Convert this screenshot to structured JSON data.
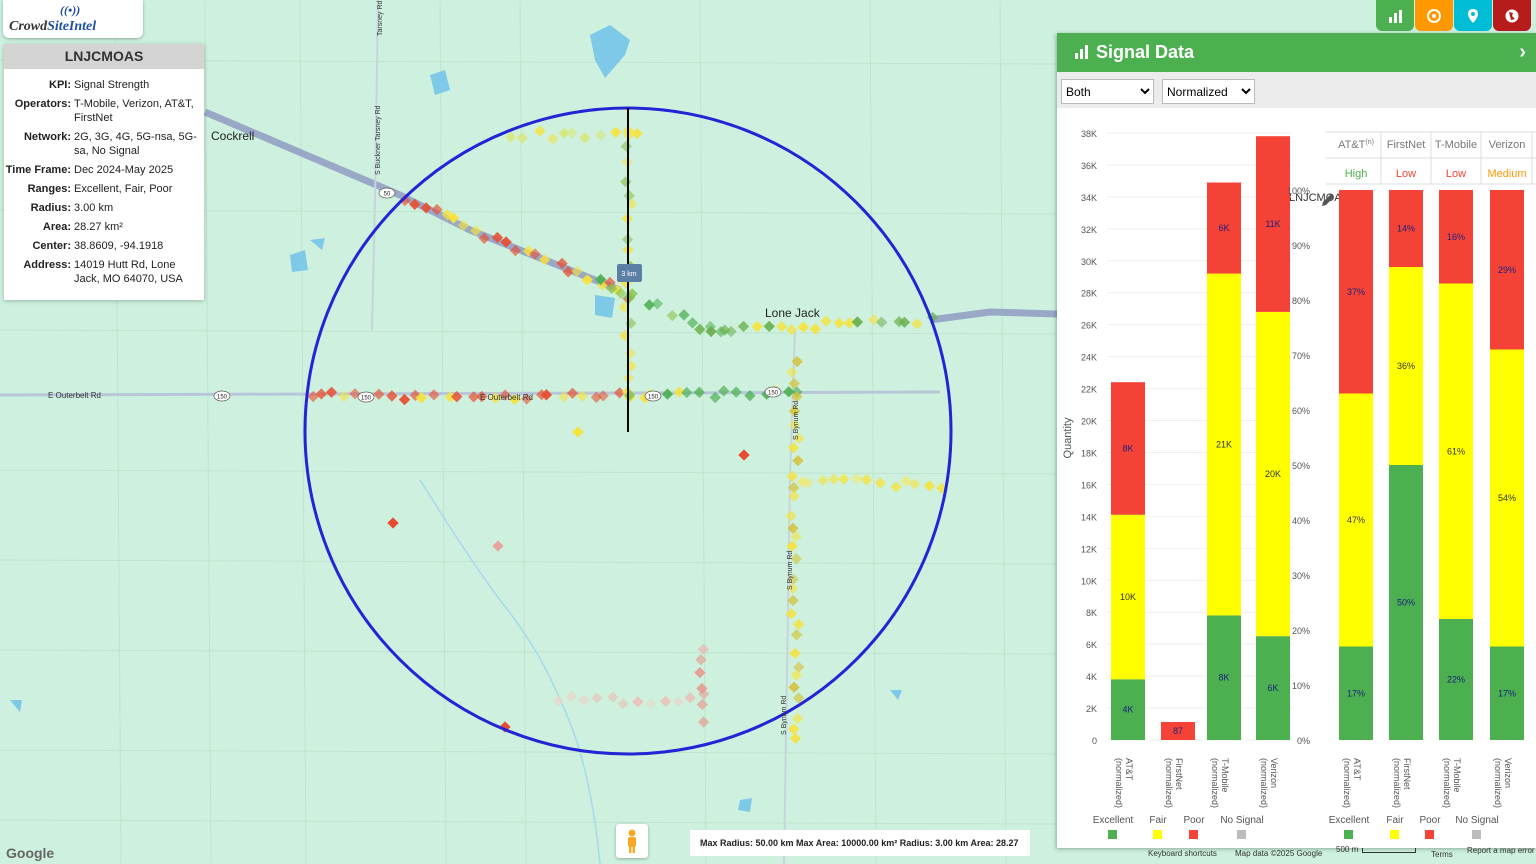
{
  "app": {
    "logo_left": "Crowd",
    "logo_right": "SiteIntel"
  },
  "info": {
    "title": "LNJCMOAS",
    "rows": [
      {
        "k": "KPI:",
        "v": "Signal Strength"
      },
      {
        "k": "Operators:",
        "v": "T-Mobile, Verizon, AT&T, FirstNet"
      },
      {
        "k": "Network:",
        "v": "2G, 3G, 4G, 5G-nsa, 5G-sa, No Signal"
      },
      {
        "k": "Time Frame:",
        "v": "Dec 2024-May 2025"
      },
      {
        "k": "Ranges:",
        "v": "Excellent, Fair, Poor"
      },
      {
        "k": "Radius:",
        "v": "3.00 km"
      },
      {
        "k": "Area:",
        "v": "28.27 km²"
      },
      {
        "k": "Center:",
        "v": "38.8609, -94.1918"
      },
      {
        "k": "Address:",
        "v": "14019 Hutt Rd, Lone Jack, MO 64070, USA"
      }
    ]
  },
  "map": {
    "places": {
      "cockrell": "Cockrell",
      "lone_jack": "Lone Jack"
    },
    "roads": {
      "outerbelt_w": "E Outerbelt Rd",
      "outerbelt_e": "E Outerbelt Rd",
      "bynum1": "S Bynum Rd",
      "bynum2": "S Bynum Rd",
      "bynum3": "S Bynum Rd",
      "buckner": "S Buckner Tarsney Rd",
      "tarsney": "Tarsney Rd"
    },
    "shields": [
      "50",
      "150",
      "150",
      "150",
      "150"
    ],
    "radius_label": "3 km",
    "scale_text": "Max Radius: 50.00 km Max Area: 10000.00 km² Radius: 3.00 km Area: 28.27 km²",
    "footer": {
      "google": "Google",
      "shortcuts": "Keyboard shortcuts",
      "mapdata": "Map data ©2025 Google",
      "scale": "500 m",
      "terms": "Terms",
      "report": "Report a map error"
    }
  },
  "toolbar": {
    "icons": [
      "bar-chart-icon",
      "target-icon",
      "location-pin-icon",
      "globe-icon"
    ],
    "colors": [
      "#4caf50",
      "#ff9800",
      "#00bcd4",
      "#b71c1c"
    ]
  },
  "panel": {
    "title": "Signal Data",
    "filter_selected": "Both",
    "mode_selected": "Normalized",
    "chart_title": "LNJCMOAS",
    "ylabel": "Quantity",
    "legend": [
      "Excellent",
      "Fair",
      "Poor",
      "No Signal"
    ],
    "colors": {
      "excellent": "#4caf50",
      "fair": "#ffff00",
      "poor": "#f44336",
      "nosignal": "#bdbdbd"
    },
    "headers": [
      "AT&T",
      "FirstNet",
      "T-Mobile",
      "Verizon"
    ],
    "header_sup": "(n)",
    "ratings": [
      {
        "t": "High",
        "c": "#4caf50"
      },
      {
        "t": "Low",
        "c": "#f44336"
      },
      {
        "t": "Low",
        "c": "#f44336"
      },
      {
        "t": "Medium",
        "c": "#ff9800"
      }
    ]
  },
  "chart_data": [
    {
      "type": "bar",
      "stacked": true,
      "title": "LNJCMOAS",
      "ylabel": "Quantity",
      "ylim": [
        0,
        38000
      ],
      "yticks": [
        "0",
        "2K",
        "4K",
        "6K",
        "8K",
        "10K",
        "12K",
        "14K",
        "16K",
        "18K",
        "20K",
        "22K",
        "24K",
        "26K",
        "28K",
        "30K",
        "32K",
        "34K",
        "36K",
        "38K"
      ],
      "categories": [
        "AT&T (normalized)",
        "FirstNet (normalized)",
        "T-Mobile (normalized)",
        "Verizon (normalized)"
      ],
      "series": [
        {
          "name": "Excellent",
          "values": [
            3800,
            0,
            7800,
            6500
          ],
          "labels": [
            "4K",
            "",
            "8K",
            "6K"
          ]
        },
        {
          "name": "Fair",
          "values": [
            10300,
            0,
            21400,
            20300
          ],
          "labels": [
            "10K",
            "",
            "21K",
            "20K"
          ]
        },
        {
          "name": "Poor",
          "values": [
            8300,
            87,
            5700,
            11000
          ],
          "labels": [
            "8K",
            "87",
            "6K",
            "11K"
          ]
        }
      ]
    },
    {
      "type": "bar",
      "stacked": true,
      "ylim": [
        0,
        100
      ],
      "yticks": [
        "0%",
        "10%",
        "20%",
        "30%",
        "40%",
        "50%",
        "60%",
        "70%",
        "80%",
        "90%",
        "100%"
      ],
      "categories": [
        "AT&T (normalized)",
        "FirstNet (normalized)",
        "T-Mobile (normalized)",
        "Verizon (normalized)"
      ],
      "series": [
        {
          "name": "Excellent",
          "values": [
            17,
            50,
            22,
            17
          ],
          "labels": [
            "17%",
            "50%",
            "22%",
            "17%"
          ]
        },
        {
          "name": "Fair",
          "values": [
            46,
            36,
            61,
            54
          ],
          "labels": [
            "47%",
            "36%",
            "61%",
            "54%"
          ]
        },
        {
          "name": "Poor",
          "values": [
            37,
            14,
            17,
            29
          ],
          "labels": [
            "37%",
            "14%",
            "16%",
            "29%"
          ]
        }
      ]
    }
  ]
}
